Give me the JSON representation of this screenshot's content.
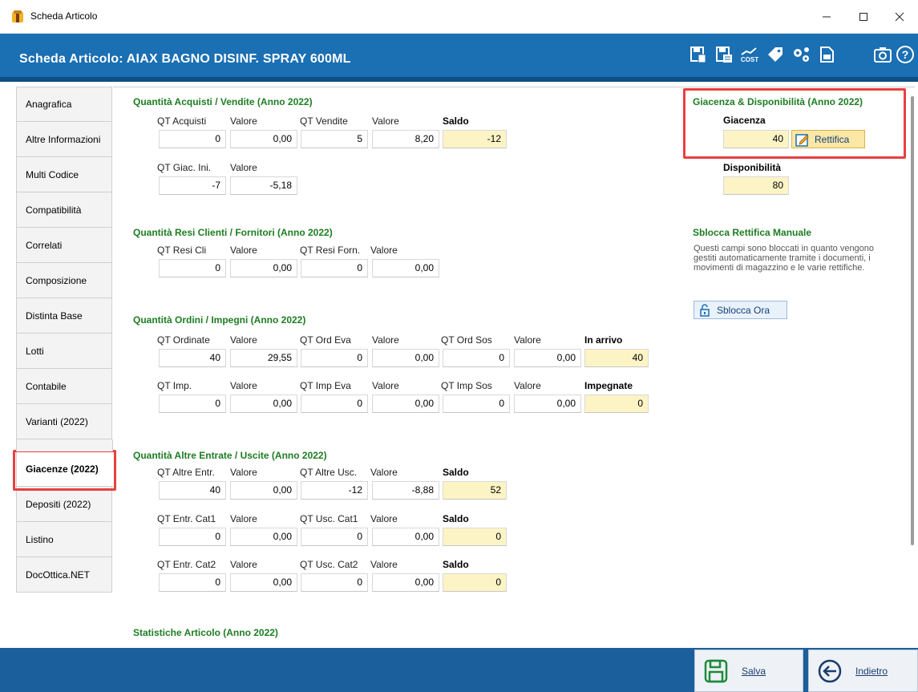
{
  "window": {
    "title": "Scheda Articolo"
  },
  "header": {
    "title": "Scheda Articolo: AIAX BAGNO DISINF. SPRAY 600ML"
  },
  "header_icons": [
    "save-document-icon",
    "save-calendar-icon",
    "cost-icon",
    "tag-icon",
    "gears-icon",
    "logo-icon",
    "camera-icon",
    "help-icon"
  ],
  "header_cost_label": "COST",
  "sidebar": {
    "items": [
      {
        "label": "Anagrafica"
      },
      {
        "label": "Altre Informazioni"
      },
      {
        "label": "Multi Codice"
      },
      {
        "label": "Compatibilità"
      },
      {
        "label": "Correlati"
      },
      {
        "label": "Composizione"
      },
      {
        "label": "Distinta Base"
      },
      {
        "label": "Lotti"
      },
      {
        "label": "Contabile"
      },
      {
        "label": "Varianti (2022)"
      },
      {
        "label": "Giacenze (2022)",
        "active": true
      },
      {
        "label": "Depositi (2022)"
      },
      {
        "label": "Listino"
      },
      {
        "label": "DocOttica.NET"
      }
    ]
  },
  "acquisti_vendite": {
    "title": "Quantità Acquisti / Vendite (Anno 2022)",
    "labels": {
      "qt_acquisti": "QT Acquisti",
      "valore1": "Valore",
      "qt_vendite": "QT Vendite",
      "valore2": "Valore",
      "saldo": "Saldo",
      "qt_giac_ini": "QT Giac. Ini.",
      "valore3": "Valore"
    },
    "values": {
      "qt_acquisti": "0",
      "valore1": "0,00",
      "qt_vendite": "5",
      "valore2": "8,20",
      "saldo": "-12",
      "qt_giac_ini": "-7",
      "valore3": "-5,18"
    }
  },
  "resi": {
    "title": "Quantità Resi Clienti / Fornitori (Anno 2022)",
    "labels": {
      "qt_resi_cli": "QT Resi Cli",
      "valore1": "Valore",
      "qt_resi_forn": "QT Resi Forn.",
      "valore2": "Valore"
    },
    "values": {
      "qt_resi_cli": "0",
      "valore1": "0,00",
      "qt_resi_forn": "0",
      "valore2": "0,00"
    }
  },
  "ordini": {
    "title": "Quantità Ordini / Impegni (Anno 2022)",
    "row1": {
      "labels": [
        "QT Ordinate",
        "Valore",
        "QT Ord Eva",
        "Valore",
        "QT Ord Sos",
        "Valore",
        "In arrivo"
      ],
      "values": [
        "40",
        "29,55",
        "0",
        "0,00",
        "0",
        "0,00",
        "40"
      ]
    },
    "row2": {
      "labels": [
        "QT Imp.",
        "Valore",
        "QT Imp Eva",
        "Valore",
        "QT Imp Sos",
        "Valore",
        "Impegnate"
      ],
      "values": [
        "0",
        "0,00",
        "0",
        "0,00",
        "0",
        "0,00",
        "0"
      ]
    }
  },
  "altre": {
    "title": "Quantità Altre Entrate / Uscite (Anno 2022)",
    "row1": {
      "labels": [
        "QT Altre Entr.",
        "Valore",
        "QT Altre Usc.",
        "Valore",
        "Saldo"
      ],
      "values": [
        "40",
        "0,00",
        "-12",
        "-8,88",
        "52"
      ]
    },
    "row2": {
      "labels": [
        "QT Entr. Cat1",
        "Valore",
        "QT Usc. Cat1",
        "Valore",
        "Saldo"
      ],
      "values": [
        "0",
        "0,00",
        "0",
        "0,00",
        "0"
      ]
    },
    "row3": {
      "labels": [
        "QT Entr. Cat2",
        "Valore",
        "QT Usc. Cat2",
        "Valore",
        "Saldo"
      ],
      "values": [
        "0",
        "0,00",
        "0",
        "0,00",
        "0"
      ]
    }
  },
  "statistiche": {
    "title": "Statistiche Articolo (Anno 2022)"
  },
  "giacenza": {
    "title": "Giacenza & Disponibilità (Anno 2022)",
    "giacenza_label": "Giacenza",
    "giacenza_value": "40",
    "rettifica_label": "Rettifica",
    "disponibilita_label": "Disponibilità",
    "disponibilita_value": "80"
  },
  "sblocca": {
    "title": "Sblocca Rettifica Manuale",
    "note": "Questi campi sono bloccati in quanto vengono gestiti automaticamente tramite i documenti, i movimenti di magazzino e le varie rettifiche.",
    "button_label": "Sblocca Ora"
  },
  "footer": {
    "save_label": "Salva",
    "back_label": "Indietro"
  },
  "colors": {
    "header_blue": "#1b6fb3",
    "section_green": "#1d7d22",
    "highlight_red": "#e8403f",
    "field_yellow": "#fdf4c6"
  }
}
